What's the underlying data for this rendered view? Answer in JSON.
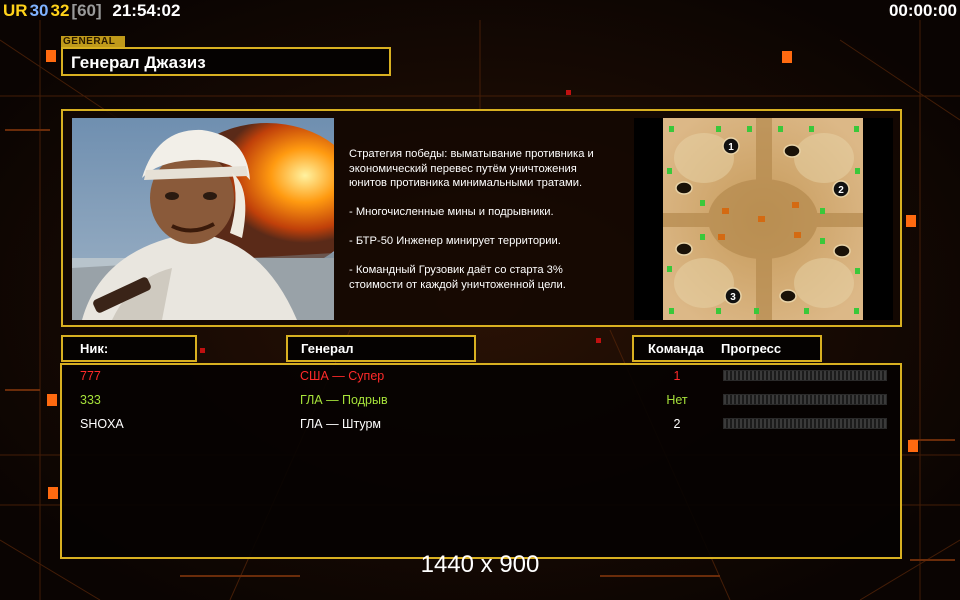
{
  "hud": {
    "ur_label": "UR",
    "fps_a": "30",
    "fps_b": "32",
    "fps_limit": "[60]",
    "clock": "21:54:02",
    "timer": "00:00:00"
  },
  "general": {
    "tag": "GENERAL",
    "name": "Генерал Джазиз"
  },
  "description": {
    "paragraphs": [
      "Стратегия победы: выматывание противника и\n экономический перевес путём уничтожения\n юнитов противника минимальными тратами.",
      "- Многочисленные мины и подрывники.",
      "- БТР-50 Инженер минирует территории.",
      "- Командный Грузовик даёт со старта 3%\n стоимости от каждой уничтоженной цели."
    ]
  },
  "map": {
    "start_positions": [
      "1",
      "2",
      "3"
    ]
  },
  "table": {
    "headers": {
      "nick": "Ник:",
      "general": "Генерал",
      "team": "Команда",
      "progress": "Прогресс"
    },
    "rows": [
      {
        "nick": "777",
        "general": "США — Супер",
        "team": "1",
        "color": "#ff2a2a",
        "progress": 0
      },
      {
        "nick": "333",
        "general": "ГЛА — Подрыв",
        "team": "Нет",
        "color": "#a6e23a",
        "progress": 0
      },
      {
        "nick": "SHOXA",
        "general": "ГЛА — Штурм",
        "team": "2",
        "color": "#ffffff",
        "progress": 0
      }
    ]
  },
  "resolution": "1440 x 900",
  "colors": {
    "accent": "#d8b021",
    "ur": "#ffd21a",
    "fps_a": "#7fb2ff",
    "fps_b": "#ffd21a",
    "fps_limit": "#9a9a9a"
  }
}
